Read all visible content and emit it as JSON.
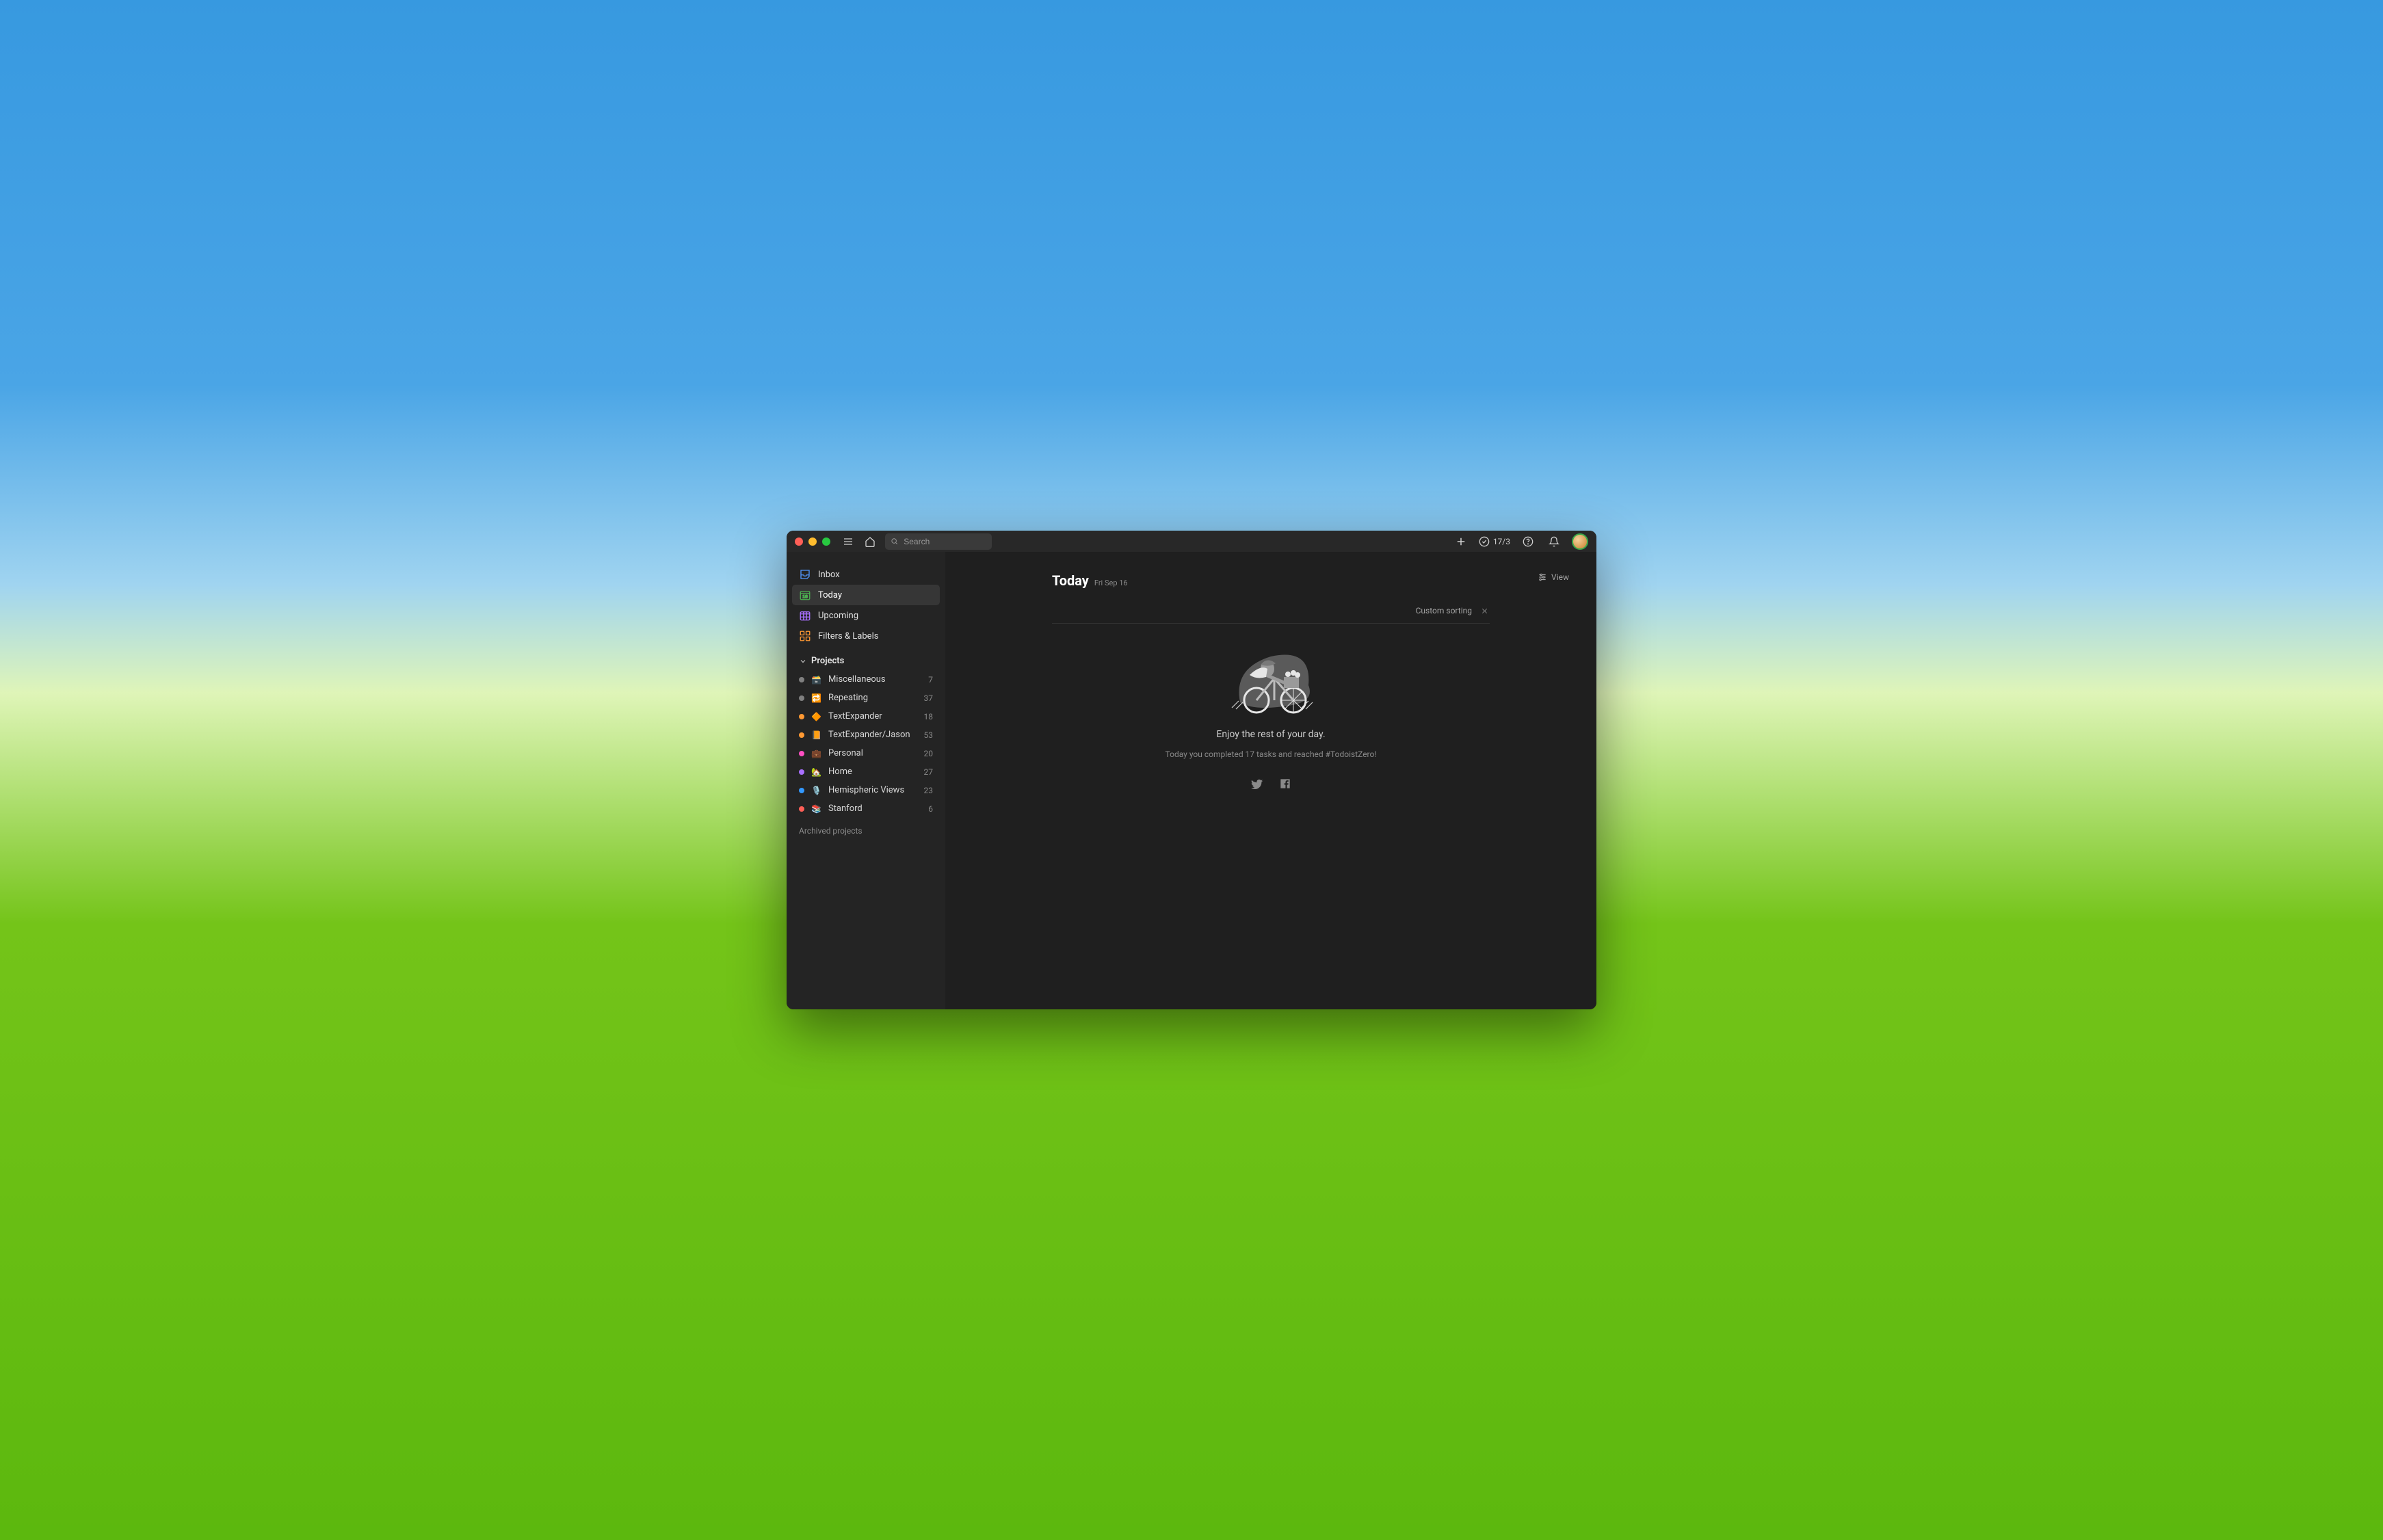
{
  "search": {
    "placeholder": "Search"
  },
  "header": {
    "productivity": "17/3"
  },
  "sidebar": {
    "nav": [
      {
        "label": "Inbox"
      },
      {
        "label": "Today"
      },
      {
        "label": "Upcoming"
      },
      {
        "label": "Filters & Labels"
      }
    ],
    "projects_header": "Projects",
    "projects": [
      {
        "emoji": "🗃️",
        "label": "Miscellaneous",
        "count": "7",
        "color": "#808080"
      },
      {
        "emoji": "🔁",
        "label": "Repeating",
        "count": "37",
        "color": "#808080"
      },
      {
        "emoji": "🔶",
        "label": "TextExpander",
        "count": "18",
        "color": "#ff9933"
      },
      {
        "emoji": "📙",
        "label": "TextExpander/Jason",
        "count": "53",
        "color": "#ff9933"
      },
      {
        "emoji": "💼",
        "label": "Personal",
        "count": "20",
        "color": "#ff4fc3"
      },
      {
        "emoji": "🏡",
        "label": "Home",
        "count": "27",
        "color": "#a970ff"
      },
      {
        "emoji": "🎙️",
        "label": "Hemispheric Views",
        "count": "23",
        "color": "#3399ff"
      },
      {
        "emoji": "📚",
        "label": "Stanford",
        "count": "6",
        "color": "#ff5f57"
      }
    ],
    "archived": "Archived projects"
  },
  "main": {
    "title": "Today",
    "date": "Fri Sep 16",
    "view_label": "View",
    "sort_label": "Custom sorting",
    "empty_title": "Enjoy the rest of your day.",
    "empty_sub": "Today you completed 17 tasks and reached #TodoistZero!"
  }
}
